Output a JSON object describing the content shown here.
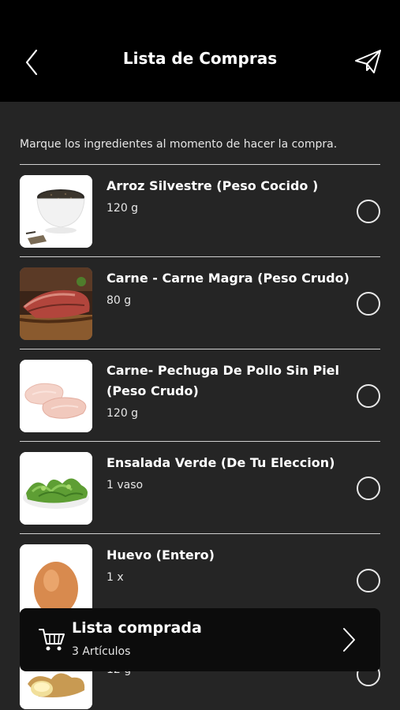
{
  "header": {
    "title": "Lista de Compras",
    "back_icon": "chevron-left-icon",
    "send_icon": "paper-plane-icon"
  },
  "instruction": "Marque los ingredientes al momento de hacer la compra.",
  "items": [
    {
      "name": "Arroz Silvestre (Peso Cocido )",
      "qty": "120 g",
      "image": "wild-rice-bowl",
      "checked": false
    },
    {
      "name": "Carne - Carne Magra (Peso Crudo)",
      "qty": "80 g",
      "image": "roast-beef",
      "checked": false
    },
    {
      "name": "Carne- Pechuga De Pollo Sin Piel (Peso Crudo)",
      "qty": "120 g",
      "image": "chicken-breast",
      "checked": false
    },
    {
      "name": "Ensalada Verde (De Tu Eleccion)",
      "qty": "1 vaso",
      "image": "green-salad",
      "checked": false
    },
    {
      "name": "Huevo (Entero)",
      "qty": "1 x",
      "image": "egg",
      "checked": false
    },
    {
      "name": "",
      "qty": "12 g",
      "image": "ginger",
      "checked": false
    }
  ],
  "bottom_bar": {
    "title": "Lista comprada",
    "count": "3 Artículos",
    "cart_icon": "shopping-cart-icon",
    "chevron_icon": "chevron-right-icon"
  },
  "colors": {
    "background": "#252525",
    "header": "#000000",
    "bar": "#0c0c0c",
    "text": "#ffffff"
  }
}
